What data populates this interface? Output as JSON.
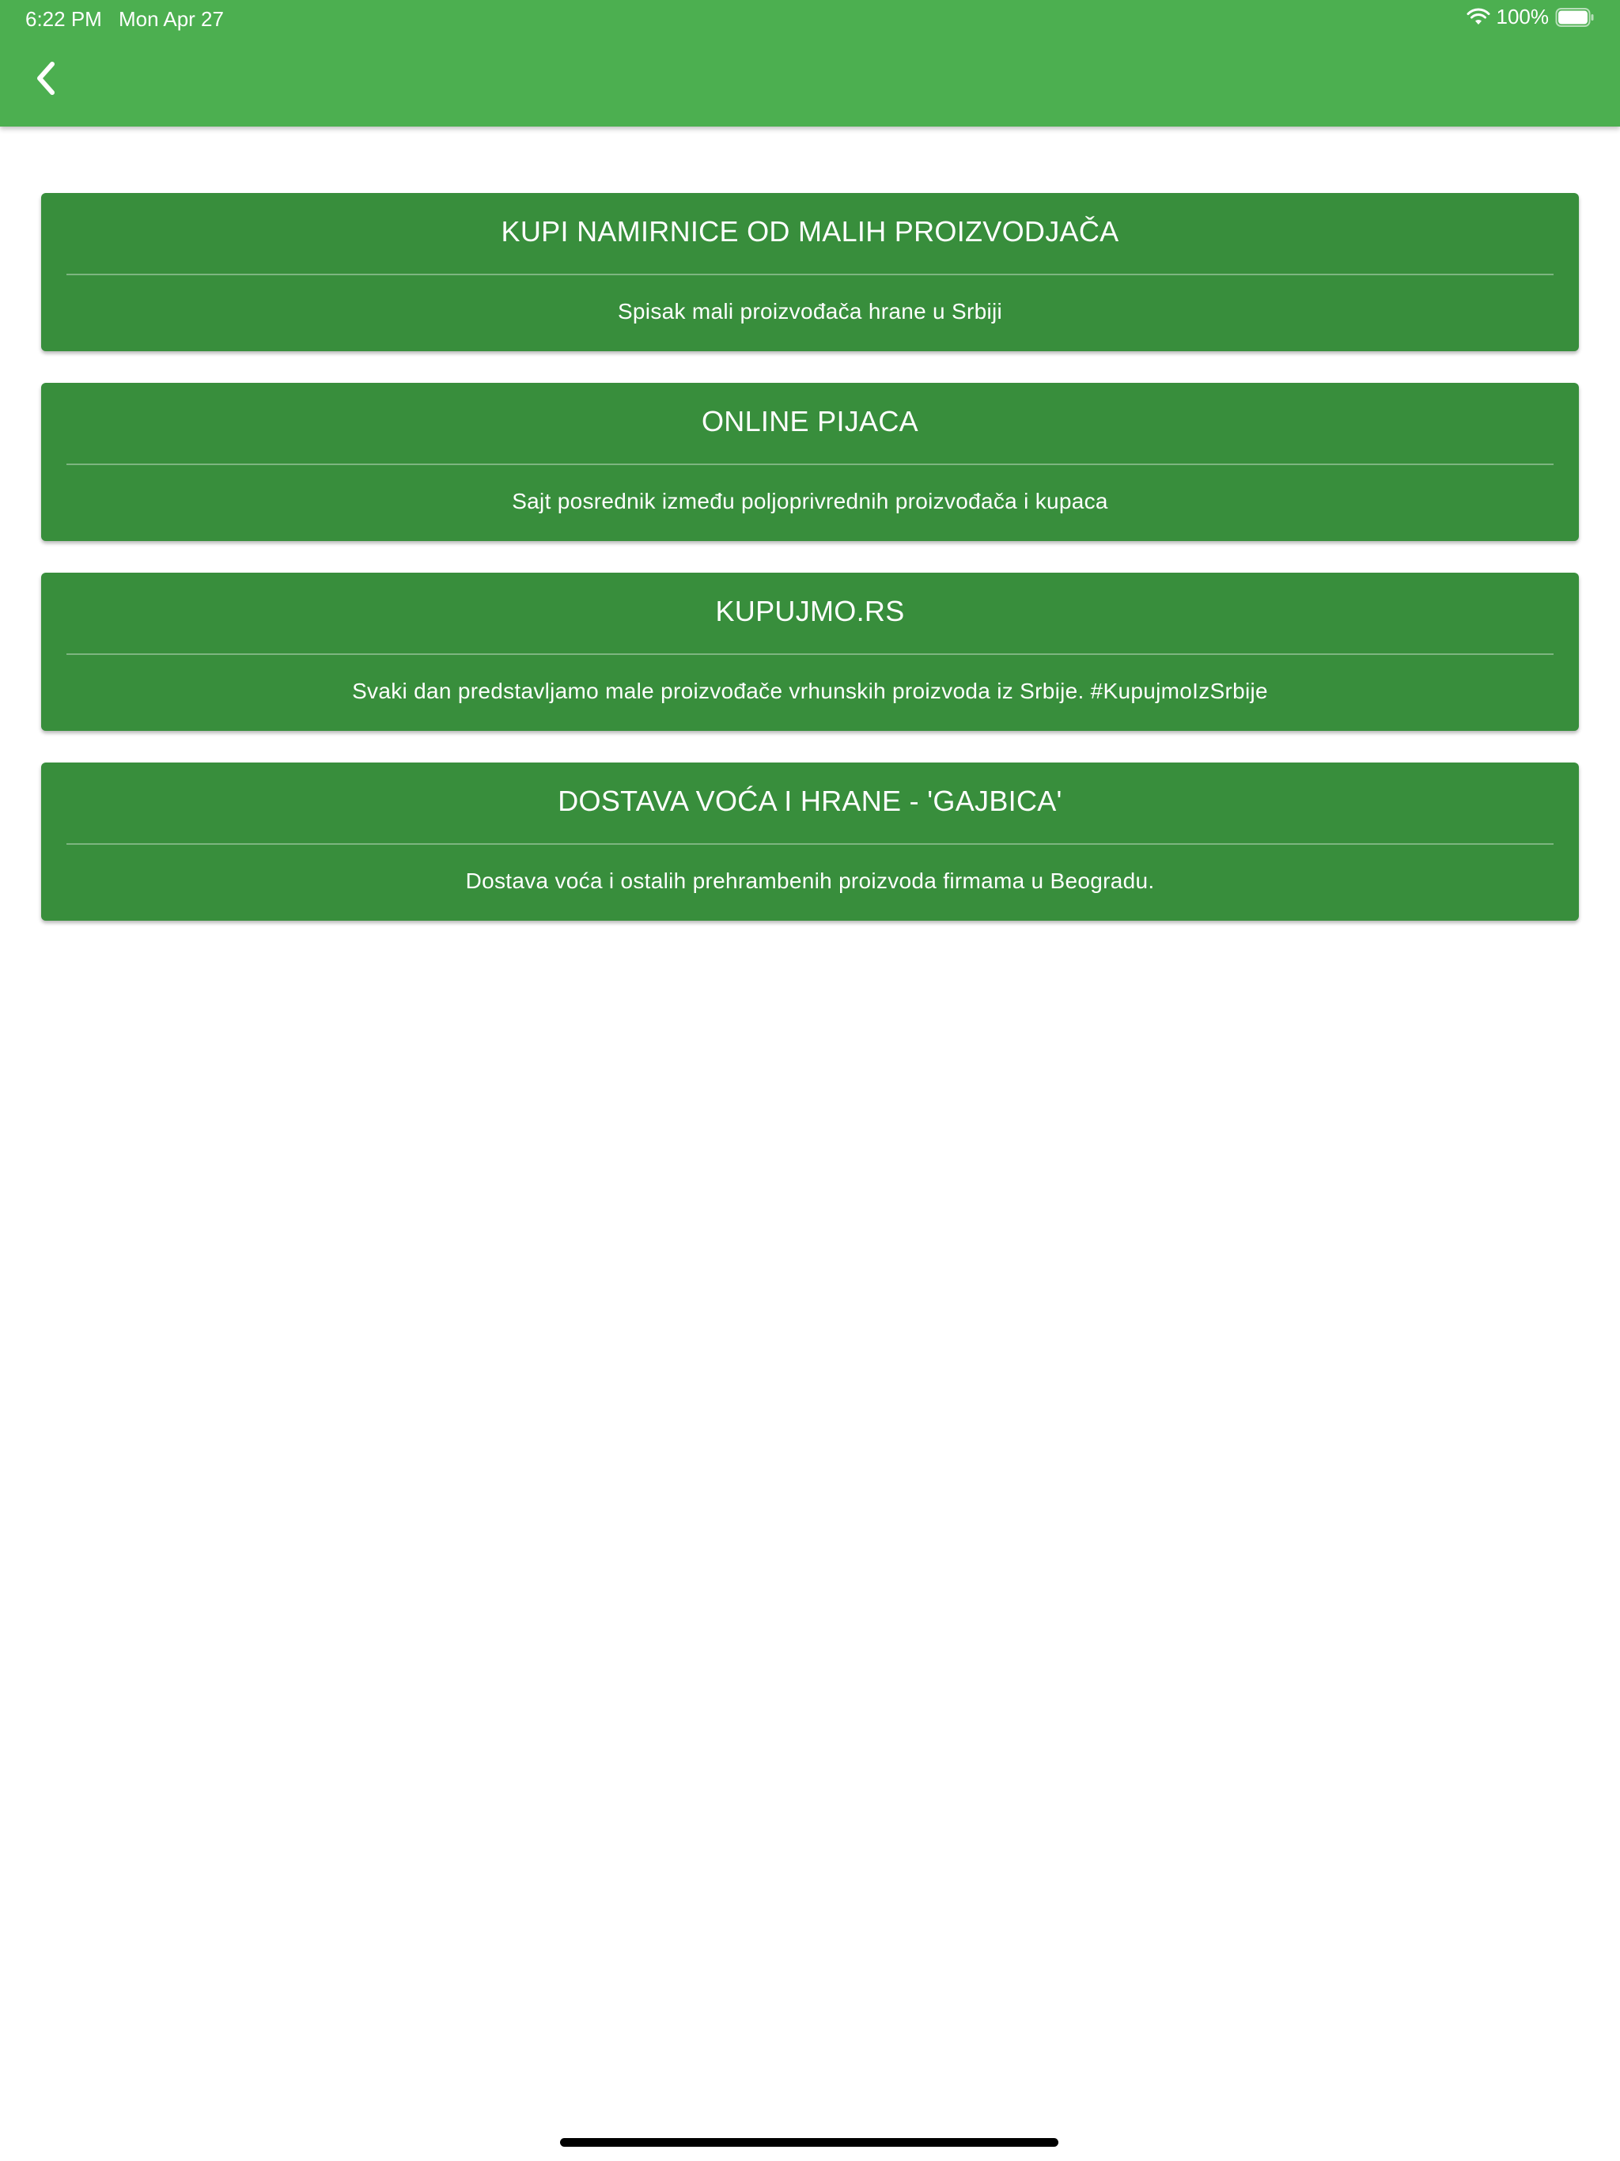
{
  "status_bar": {
    "time": "6:22 PM",
    "date": "Mon Apr 27",
    "battery": "100%"
  },
  "appbar": {
    "back_icon": "chevron-left-icon",
    "color": "#4caf50"
  },
  "cards": [
    {
      "title": "KUPI NAMIRNICE OD MALIH PROIZVODJAČA",
      "subtitle": "Spisak mali proizvođača hrane u Srbiji"
    },
    {
      "title": "ONLINE PIJACA",
      "subtitle": "Sajt posrednik između poljoprivrednih proizvođača i kupaca"
    },
    {
      "title": "KUPUJMO.RS",
      "subtitle": "Svaki dan predstavljamo male proizvođače vrhunskih proizvoda iz Srbije. #KupujmoIzSrbije"
    },
    {
      "title": "DOSTAVA VOĆA I HRANE - 'GAJBICA'",
      "subtitle": "Dostava voća i ostalih prehrambenih proizvoda firmama u Beogradu."
    }
  ],
  "colors": {
    "card": "#388e3c",
    "text": "#ffffff"
  }
}
